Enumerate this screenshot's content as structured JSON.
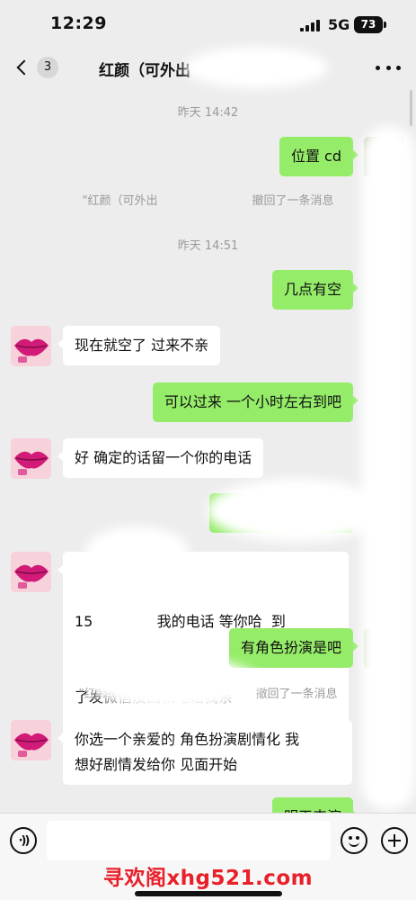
{
  "status_bar": {
    "time": "12:29",
    "network": "5G",
    "battery": "73"
  },
  "header": {
    "unread_count": "3",
    "title": "红颜（可外出",
    "icons": [
      "chevron-left-icon",
      "more-icon"
    ]
  },
  "messages": [
    {
      "kind": "timestamp",
      "text": "昨天 14:42"
    },
    {
      "kind": "outgoing",
      "text": "位置 cd"
    },
    {
      "kind": "system",
      "prefix": "\"红颜（可外出",
      "suffix": "撤回了一条消息"
    },
    {
      "kind": "timestamp",
      "text": "昨天 14:51"
    },
    {
      "kind": "outgoing",
      "text": "几点有空"
    },
    {
      "kind": "incoming",
      "text": "现在就空了 过来不亲"
    },
    {
      "kind": "outgoing",
      "text": "可以过来 一个小时左右到吧"
    },
    {
      "kind": "incoming",
      "text": "好 确定的话留一个你的电话"
    },
    {
      "kind": "incoming",
      "lines": [
        "15              我的电话 等你哈  到",
        "了发微信没回就电话我亲"
      ]
    },
    {
      "kind": "outgoing",
      "text": "有角色扮演是吧"
    },
    {
      "kind": "system",
      "prefix": "\"红颜",
      "suffix": "撤回了一条消息"
    },
    {
      "kind": "incoming",
      "lines": [
        "你选一个亲爱的 角色扮演剧情化 我",
        "想好剧情发给你 见面开始"
      ]
    },
    {
      "kind": "outgoing",
      "text": "明天来演"
    }
  ],
  "input_bar": {
    "placeholder": "",
    "watermark": "寻欢阁xhg521.com",
    "icons": [
      "voice-icon",
      "emoji-icon",
      "plus-icon"
    ]
  },
  "colors": {
    "background": "#ededed",
    "outgoing_bubble": "#95ec69",
    "incoming_bubble": "#ffffff",
    "watermark": "#e8202a"
  }
}
